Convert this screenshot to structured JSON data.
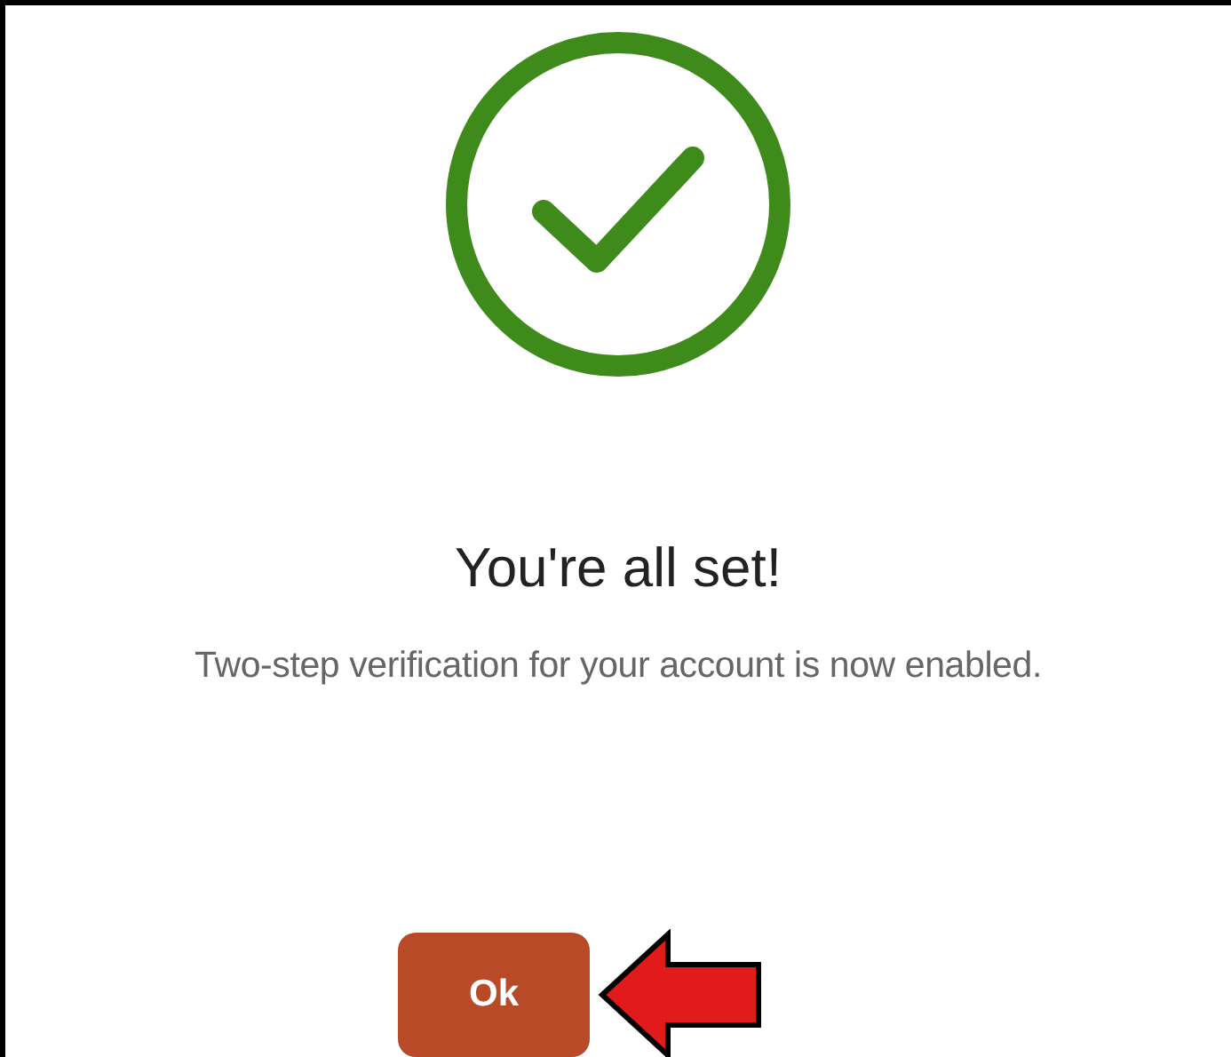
{
  "dialog": {
    "title": "You're all set!",
    "message": "Two-step verification for your account is now enabled.",
    "button": {
      "label": "Ok"
    }
  }
}
